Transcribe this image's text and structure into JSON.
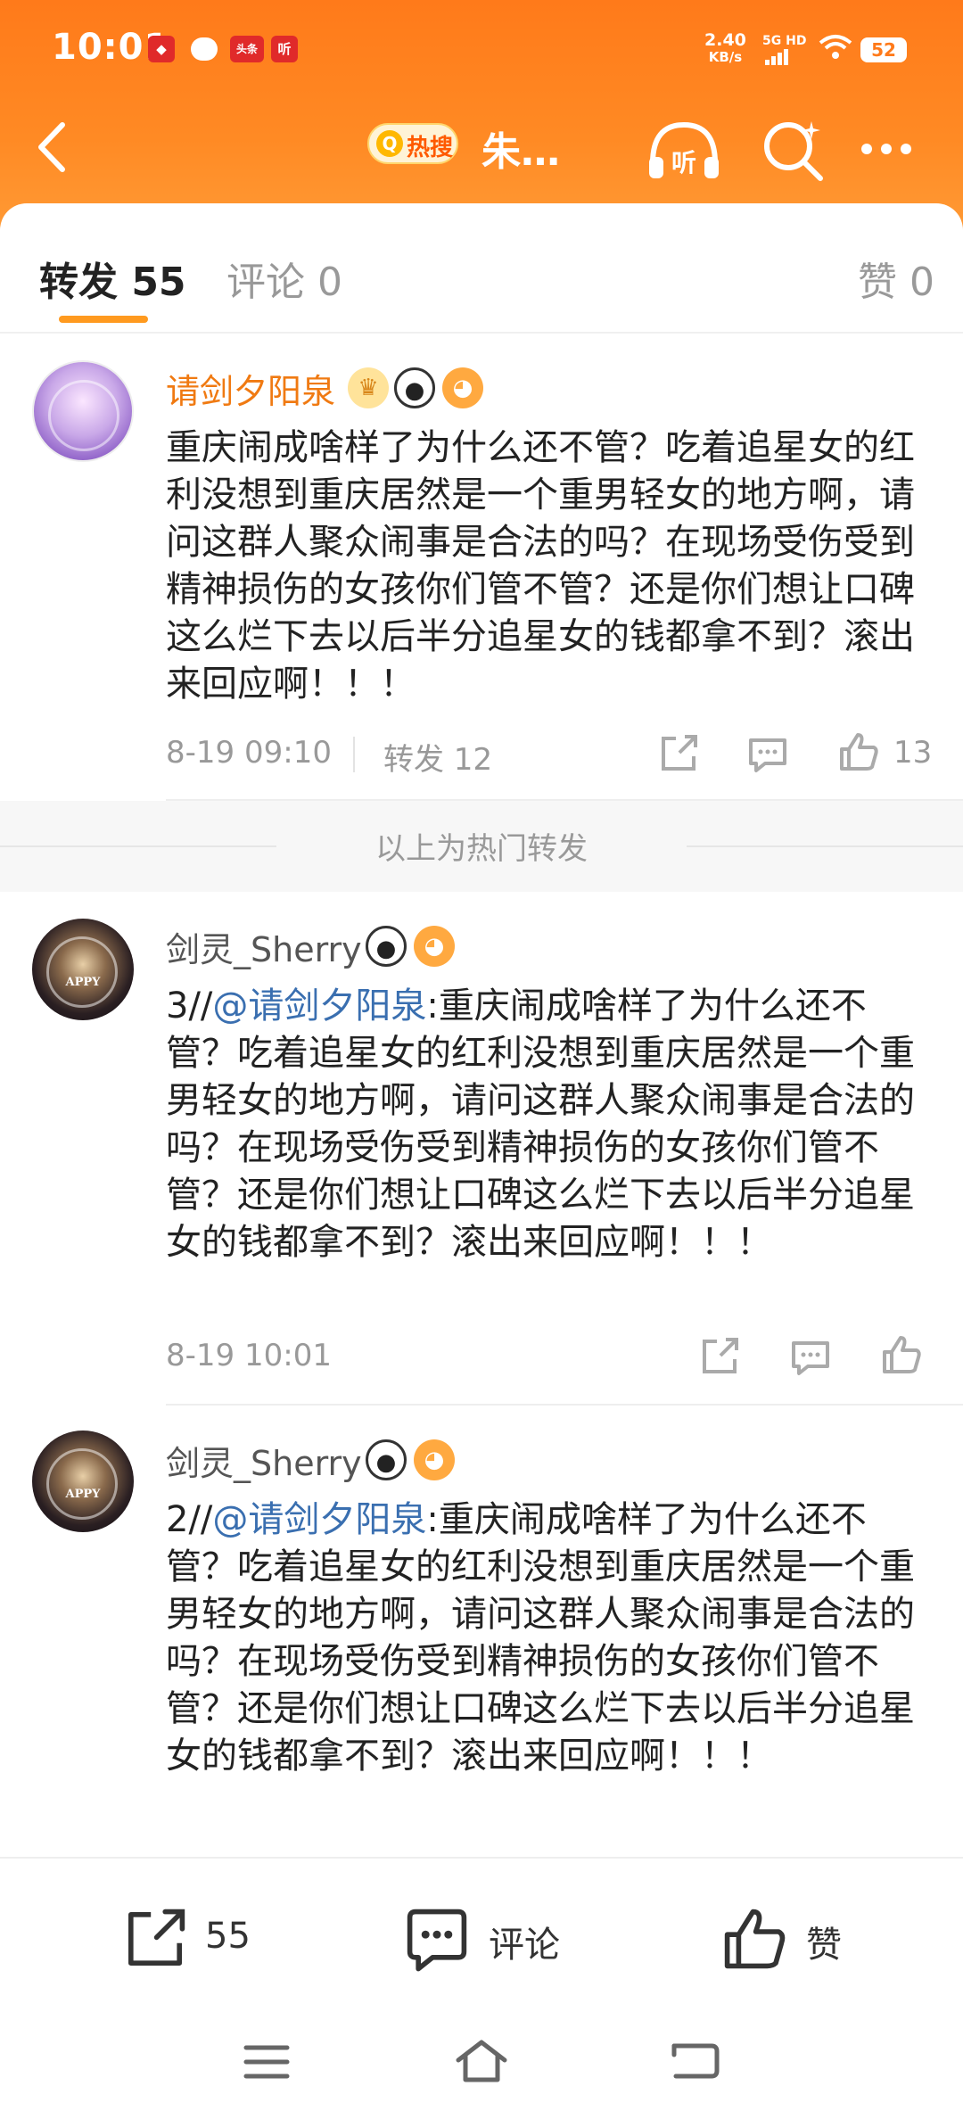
{
  "status_bar": {
    "time": "10:01",
    "app_icons": [
      "头条",
      "听"
    ],
    "net_speed": "2.40",
    "net_speed_unit": "KB/s",
    "network": "5G HD",
    "battery": "52"
  },
  "navbar": {
    "hot_label": "热搜",
    "title": "朱…"
  },
  "tabs": [
    {
      "label": "转发 55",
      "active": true
    },
    {
      "label": "评论 0",
      "active": false
    },
    {
      "label": "赞 0",
      "active": false
    }
  ],
  "posts": [
    {
      "username": "请剑夕阳泉",
      "content": "重庆闹成啥样了为什么还不管？吃着追星女的红利没想到重庆居然是一个重男轻女的地方啊，请问这群人聚众闹事是合法的吗？在现场受伤受到精神损伤的女孩你们管不管？还是你们想让口碑这么烂下去以后半分追星女的钱都拿不到？滚出来回应啊！！！",
      "time": "8-19 09:10",
      "repost_label": "转发 12",
      "like_count": "13"
    },
    {
      "username": "剑灵_Sherry",
      "prefix": "3//",
      "mention": "@请剑夕阳泉",
      "content": ":重庆闹成啥样了为什么还不管？吃着追星女的红利没想到重庆居然是一个重男轻女的地方啊，请问这群人聚众闹事是合法的吗？在现场受伤受到精神损伤的女孩你们管不管？还是你们想让口碑这么烂下去以后半分追星女的钱都拿不到？滚出来回应啊！！！",
      "time": "8-19 10:01"
    },
    {
      "username": "剑灵_Sherry",
      "prefix": "2//",
      "mention": "@请剑夕阳泉",
      "content": ":重庆闹成啥样了为什么还不管？吃着追星女的红利没想到重庆居然是一个重男轻女的地方啊，请问这群人聚众闹事是合法的吗？在现场受伤受到精神损伤的女孩你们管不管？还是你们想让口碑这么烂下去以后半分追星女的钱都拿不到？滚出来回应啊！！！"
    }
  ],
  "hot_divider": "以上为热门转发",
  "bottom_bar": {
    "repost_count": "55",
    "comment_label": "评论",
    "like_label": "赞"
  },
  "colors": {
    "header_orange": "#ff7a1a",
    "username_orange": "#f07a12",
    "mention_blue": "#3a6fb0",
    "tab_indicator": "#ff9a1f"
  },
  "icons": {
    "status": [
      "chat-icon",
      "signal-icon",
      "wifi-icon",
      "battery-icon"
    ],
    "nav": [
      "back-arrow-icon",
      "listen-icon",
      "search-icon",
      "more-icon"
    ],
    "actions": [
      "share-icon",
      "comment-icon",
      "like-icon"
    ],
    "system": [
      "menu-icon",
      "home-icon",
      "back-icon"
    ]
  }
}
